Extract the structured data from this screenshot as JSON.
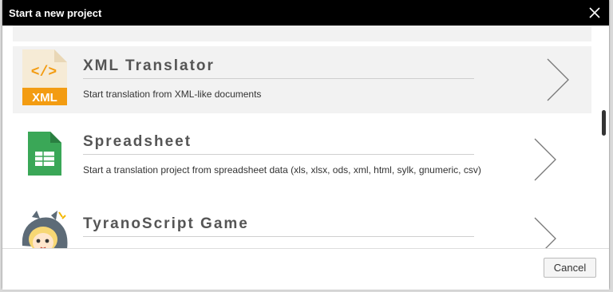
{
  "dialog": {
    "title": "Start a new project",
    "close_icon": "close-icon"
  },
  "projects": [
    {
      "title": "XML Translator",
      "description": "Start translation from XML-like documents",
      "icon": "xml-file-icon",
      "icon_label": "XML",
      "icon_code": "</>",
      "highlighted": true
    },
    {
      "title": "Spreadsheet",
      "description": "Start a translation project from spreadsheet data (xls, xlsx, ods, xml, html, sylk, gnumeric, csv)",
      "icon": "spreadsheet-icon",
      "highlighted": false
    },
    {
      "title": "TyranoScript Game",
      "description": "",
      "icon": "tyranoscript-mascot-icon",
      "highlighted": false
    }
  ],
  "footer": {
    "cancel_label": "Cancel"
  },
  "colors": {
    "titlebar": "#000000",
    "xml_icon_orange": "#f39c12",
    "spreadsheet_green": "#3aa757"
  }
}
